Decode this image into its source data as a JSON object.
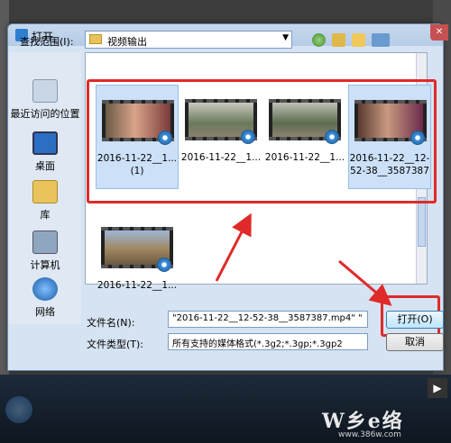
{
  "dialog": {
    "title": "打开",
    "close_label": "✕",
    "look_in_label": "查找范围(I):",
    "look_in_value": "视频输出"
  },
  "places": [
    {
      "label": "最近访问的位置",
      "icon": "recent-places-icon"
    },
    {
      "label": "桌面",
      "icon": "desktop-icon"
    },
    {
      "label": "库",
      "icon": "libraries-icon"
    },
    {
      "label": "计算机",
      "icon": "computer-icon"
    },
    {
      "label": "网络",
      "icon": "network-icon"
    }
  ],
  "files": [
    {
      "name": "2016-11-22__1...(1)",
      "line1": "2016-11-22__1...",
      "line2": "(1)",
      "selected": true
    },
    {
      "name": "2016-11-22__1...",
      "line1": "2016-11-22__1...",
      "line2": "",
      "selected": false
    },
    {
      "name": "2016-11-22__1...",
      "line1": "2016-11-22__1...",
      "line2": "",
      "selected": false
    },
    {
      "name": "2016-11-22__12-52-38__3587387",
      "line1": "2016-11-22__12-",
      "line2": "52-38__3587387",
      "selected": true
    },
    {
      "name": "2016-11-22__1...",
      "line1": "2016-11-22__1...",
      "line2": "",
      "selected": false
    }
  ],
  "form": {
    "filename_label": "文件名(N):",
    "filename_value": "\"2016-11-22__12-52-38__3587387.mp4\" \"",
    "filetype_label": "文件类型(T):",
    "filetype_value": "所有支持的媒体格式(*.3g2;*.3gp;*.3gp2"
  },
  "buttons": {
    "open": "打开(O)",
    "cancel": "取消"
  },
  "watermark": {
    "big": "W乡e络",
    "small": "www.386w.com"
  },
  "colors": {
    "accent_red": "#e02a2a",
    "selection": "#cce0f7",
    "dialog_bg": "#d6e3f2"
  }
}
